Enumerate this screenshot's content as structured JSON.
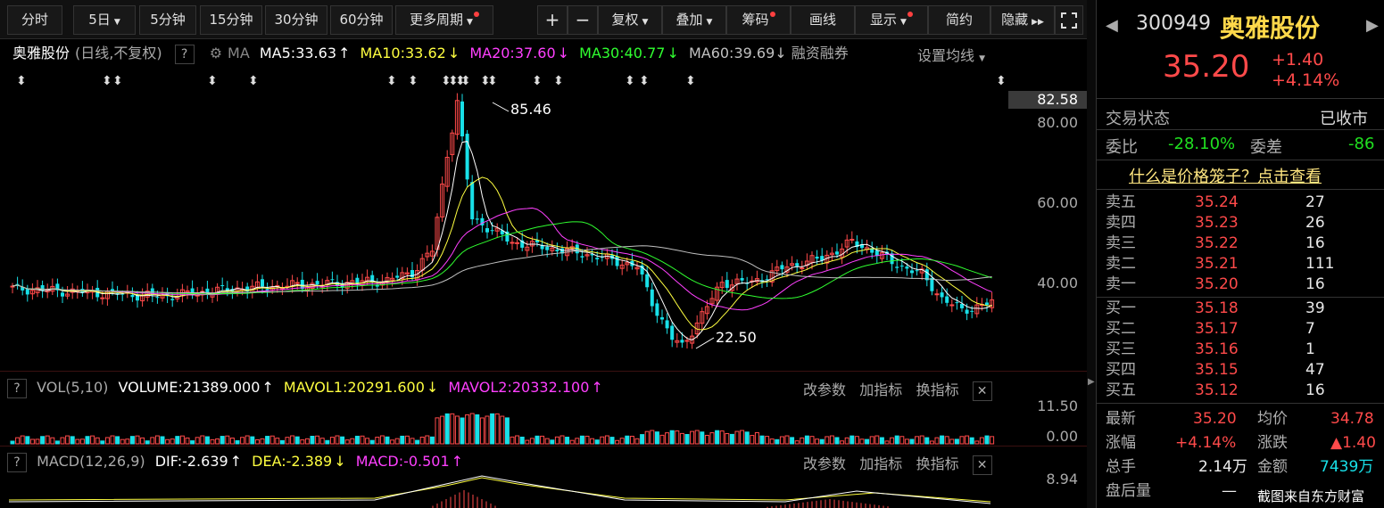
{
  "toolbar": {
    "items": [
      "分时",
      "5日",
      "5分钟",
      "15分钟",
      "30分钟",
      "60分钟",
      "更多周期"
    ],
    "right_items": [
      "+",
      "−",
      "复权",
      "叠加",
      "筹码",
      "画线",
      "显示",
      "简约",
      "隐藏"
    ],
    "forward_icon": "»"
  },
  "main": {
    "name": "奥雅股份",
    "mode": "(日线,不复权)",
    "q": "?",
    "ma_label": "MA",
    "ma5": "MA5:33.63",
    "ma10": "MA10:33.62",
    "ma20": "MA20:37.60",
    "ma30": "MA30:40.77",
    "ma60": "MA60:39.69",
    "extra": "融资融券",
    "set_ma": "设置均线",
    "price_top": "82.58",
    "y_labels": [
      "80.00",
      "60.00",
      "40.00"
    ],
    "high_label": "85.46",
    "low_label": "22.50"
  },
  "volume": {
    "q": "?",
    "title": "VOL(5,10)",
    "volume": "VOLUME:21389.000",
    "mavol1": "MAVOL1:20291.600",
    "mavol2": "MAVOL2:20332.100",
    "btn1": "改参数",
    "btn2": "加指标",
    "btn3": "换指标",
    "y_top": "11.50",
    "y_bottom": "0.00"
  },
  "macd": {
    "q": "?",
    "title": "MACD(12,26,9)",
    "dif": "DIF:-2.639",
    "dea": "DEA:-2.389",
    "macd": "MACD:-0.501",
    "btn1": "改参数",
    "btn2": "加指标",
    "btn3": "换指标",
    "y_top": "8.94"
  },
  "quote": {
    "code": "300949",
    "name": "奥雅股份",
    "price": "35.20",
    "change": "+1.40",
    "change_pct": "+4.14%",
    "status_label": "交易状态",
    "status": "已收市",
    "wb_label": "委比",
    "wb": "-28.10%",
    "wc_label": "委差",
    "wc": "-86",
    "link": "什么是价格笼子？点击查看",
    "asks": [
      {
        "label": "卖五",
        "price": "35.24",
        "vol": "27"
      },
      {
        "label": "卖四",
        "price": "35.23",
        "vol": "26"
      },
      {
        "label": "卖三",
        "price": "35.22",
        "vol": "16"
      },
      {
        "label": "卖二",
        "price": "35.21",
        "vol": "111"
      },
      {
        "label": "卖一",
        "price": "35.20",
        "vol": "16"
      }
    ],
    "bids": [
      {
        "label": "买一",
        "price": "35.18",
        "vol": "39"
      },
      {
        "label": "买二",
        "price": "35.17",
        "vol": "7"
      },
      {
        "label": "买三",
        "price": "35.16",
        "vol": "1"
      },
      {
        "label": "买四",
        "price": "35.15",
        "vol": "47"
      },
      {
        "label": "买五",
        "price": "35.12",
        "vol": "16"
      }
    ],
    "latest_label": "最新",
    "latest": "35.20",
    "avg_label": "均价",
    "avg": "34.78",
    "zf_label": "涨幅",
    "zf": "+4.14%",
    "zd_label": "涨跌",
    "zd": "▲1.40",
    "zs_label": "总手",
    "zs": "2.14万",
    "je_label": "金额",
    "je": "7439万",
    "ph_label": "盘后量",
    "ph": "—",
    "watermark": "截图来自东方财富"
  },
  "colors": {
    "up": "#ff4a4a",
    "down": "#18e0e8",
    "ma5": "#ffffff",
    "ma10": "#ffff40",
    "ma20": "#ff40ff",
    "ma30": "#30ff30",
    "ma60": "#c0c0c0"
  }
}
